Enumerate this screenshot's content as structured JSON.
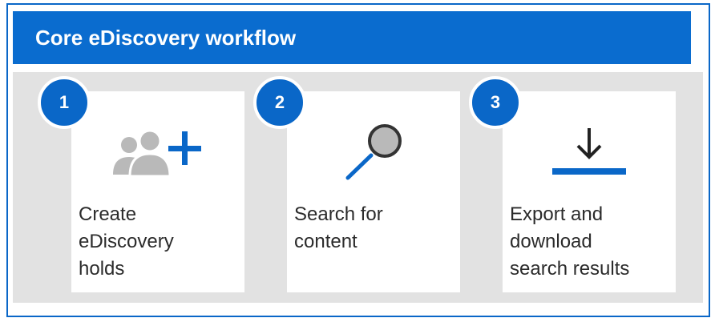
{
  "header": {
    "title": "Core eDiscovery workflow"
  },
  "steps": [
    {
      "number": "1",
      "icon": "add-people-icon",
      "lines": [
        "Create",
        "eDiscovery",
        "holds"
      ]
    },
    {
      "number": "2",
      "icon": "search-icon",
      "lines": [
        "Search for",
        "content"
      ]
    },
    {
      "number": "3",
      "icon": "download-icon",
      "lines": [
        "Export and",
        "download",
        "search results"
      ]
    }
  ],
  "colors": {
    "accent": "#0a67c8",
    "panel": "#e2e2e2",
    "icon_gray": "#b9b9b9"
  }
}
